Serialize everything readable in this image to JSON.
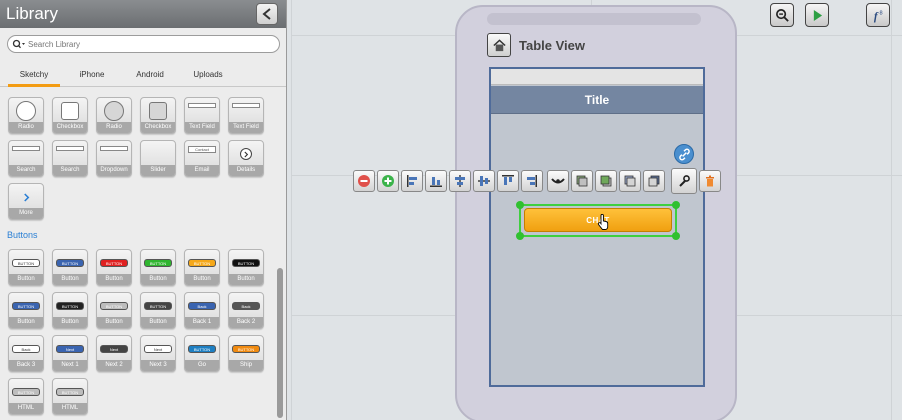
{
  "sidebar": {
    "title": "Library",
    "search": {
      "placeholder": "Search Library"
    },
    "tabs": [
      {
        "label": "Sketchy",
        "active": true
      },
      {
        "label": "iPhone",
        "active": false
      },
      {
        "label": "Android",
        "active": false
      },
      {
        "label": "Uploads",
        "active": false
      }
    ],
    "controls": [
      "Radio",
      "Checkbox",
      "Radio",
      "Checkbox",
      "Text Field",
      "Text Field",
      "Search",
      "Search",
      "Dropdown",
      "Slider",
      "Email",
      "Details",
      "More"
    ],
    "preview_texts": {
      "email": "Contact"
    },
    "section_buttons": "Buttons",
    "buttons": [
      {
        "label": "Button",
        "text": "BUTTON",
        "color": "#ffffff",
        "fg": "#333333"
      },
      {
        "label": "Button",
        "text": "BUTTON",
        "color": "#3a64b0",
        "fg": "#ffffff"
      },
      {
        "label": "Button",
        "text": "BUTTON",
        "color": "#e02020",
        "fg": "#ffffff"
      },
      {
        "label": "Button",
        "text": "BUTTON",
        "color": "#2fb52f",
        "fg": "#ffffff"
      },
      {
        "label": "Button",
        "text": "BUTTON",
        "color": "#f5a81a",
        "fg": "#ffffff"
      },
      {
        "label": "Button",
        "text": "BUTTON",
        "color": "#111111",
        "fg": "#ffffff"
      },
      {
        "label": "Button",
        "text": "BUTTON",
        "color": "#3a64b0",
        "fg": "#ffffff"
      },
      {
        "label": "Button",
        "text": "BUTTON",
        "color": "#222222",
        "fg": "#ffffff"
      },
      {
        "label": "Button",
        "text": "BUTTON",
        "color": "#bdbdbd",
        "fg": "#ffffff"
      },
      {
        "label": "Button",
        "text": "BUTTON",
        "color": "#444444",
        "fg": "#ffffff"
      },
      {
        "label": "Back 1",
        "text": "Back",
        "color": "#3a64b0",
        "fg": "#ffffff"
      },
      {
        "label": "Back 2",
        "text": "Back",
        "color": "#555555",
        "fg": "#ffffff"
      },
      {
        "label": "Back 3",
        "text": "Back",
        "color": "#ffffff",
        "fg": "#333333"
      },
      {
        "label": "Next 1",
        "text": "Next",
        "color": "#3a64b0",
        "fg": "#ffffff"
      },
      {
        "label": "Next 2",
        "text": "Next",
        "color": "#444444",
        "fg": "#ffffff"
      },
      {
        "label": "Next 3",
        "text": "Next",
        "color": "#ffffff",
        "fg": "#333333"
      },
      {
        "label": "Go",
        "text": "BUTTON",
        "color": "#1e7fc2",
        "fg": "#ffffff"
      },
      {
        "label": "Ship",
        "text": "BUTTON",
        "color": "#f08a10",
        "fg": "#ffffff"
      },
      {
        "label": "HTML",
        "text": "BUTTON",
        "color": "#bdbdbd",
        "fg": "#ffffff"
      },
      {
        "label": "HTML",
        "text": "BUTTON",
        "color": "#bdbdbd",
        "fg": "#ffffff"
      }
    ]
  },
  "canvas": {
    "screen_title": "Table View",
    "nav_title": "Title",
    "selected_button_text": "CHAT",
    "colors": {
      "accent_tab": "#f39c12",
      "selection": "#3fcf3f",
      "nav_bar": "#7486a1",
      "selected_button": "#f5a81a",
      "link": "#4a8fcf"
    },
    "toolbar_icons": [
      "remove-icon",
      "add-icon",
      "align-left-icon",
      "align-bottom-icon",
      "align-center-icon",
      "align-middle-icon",
      "align-top-icon",
      "align-right-icon",
      "distribute-icon",
      "bring-front-icon",
      "bring-forward-icon",
      "send-backward-icon",
      "send-back-icon",
      "wrench-icon",
      "trash-icon"
    ]
  }
}
